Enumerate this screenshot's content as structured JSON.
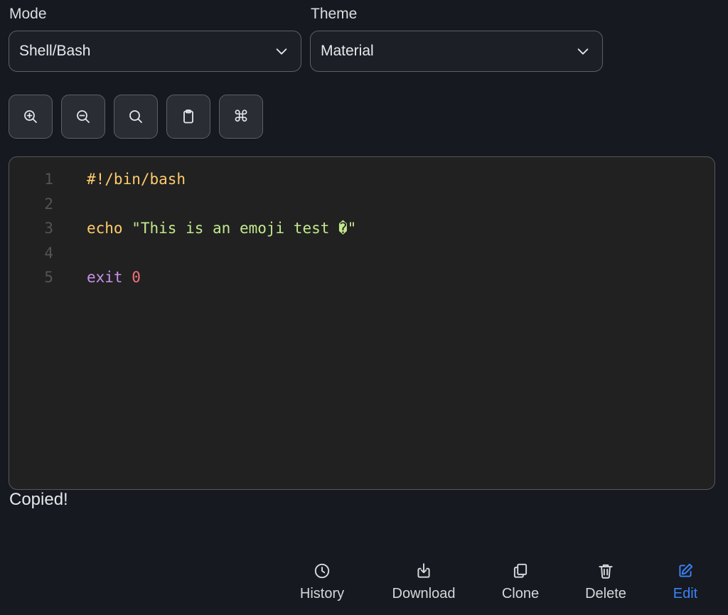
{
  "mode": {
    "label": "Mode",
    "value": "Shell/Bash"
  },
  "theme": {
    "label": "Theme",
    "value": "Material"
  },
  "toolbar": [
    {
      "name": "zoom-in-button",
      "icon": "zoom-in-icon"
    },
    {
      "name": "zoom-out-button",
      "icon": "zoom-out-icon"
    },
    {
      "name": "search-button",
      "icon": "search-icon"
    },
    {
      "name": "copy-button",
      "icon": "clipboard-icon"
    },
    {
      "name": "command-palette-button",
      "icon": "command-icon",
      "glyph": "⌘"
    }
  ],
  "editor": {
    "lines": [
      {
        "number": "1",
        "tokens": [
          {
            "text": "#!/bin/bash",
            "type": "shebang"
          }
        ]
      },
      {
        "number": "2",
        "tokens": []
      },
      {
        "number": "3",
        "tokens": [
          {
            "text": "echo",
            "type": "builtin"
          },
          {
            "text": " ",
            "type": "plain"
          },
          {
            "text": "\"This is an emoji test �\"",
            "type": "string"
          }
        ]
      },
      {
        "number": "4",
        "tokens": []
      },
      {
        "number": "5",
        "tokens": [
          {
            "text": "exit",
            "type": "keyword"
          },
          {
            "text": " ",
            "type": "plain"
          },
          {
            "text": "0",
            "type": "number"
          }
        ]
      }
    ]
  },
  "status": "Copied!",
  "actions": {
    "history": "History",
    "download": "Download",
    "clone": "Clone",
    "delete": "Delete",
    "edit": "Edit"
  },
  "colors": {
    "background": "#161920",
    "editor_background": "#212121",
    "accent": "#3b82f6"
  }
}
